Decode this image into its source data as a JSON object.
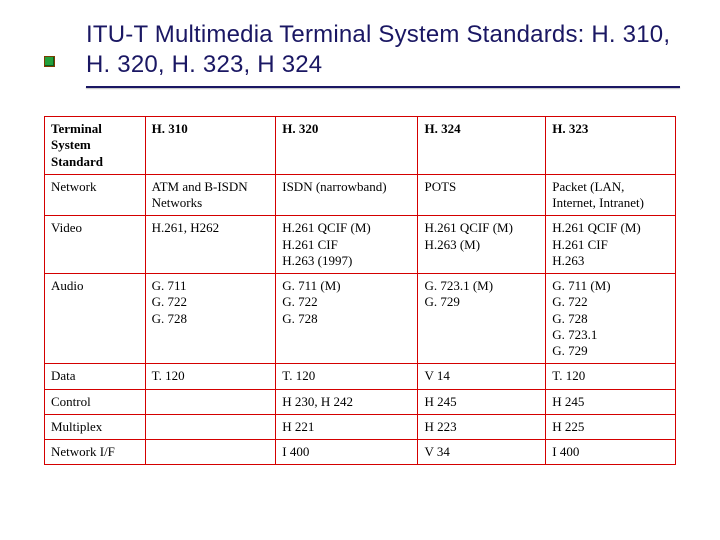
{
  "title": "ITU-T Multimedia Terminal System Standards: H. 310, H. 320, H. 323, H 324",
  "table": {
    "header": [
      "Terminal System Standard",
      "H. 310",
      "H. 320",
      "H. 324",
      "H. 323"
    ],
    "rows": [
      {
        "label": "Network",
        "cells": [
          "ATM and B-ISDN Networks",
          "ISDN (narrowband)",
          "POTS",
          "Packet (LAN, Internet, Intranet)"
        ]
      },
      {
        "label": "Video",
        "cells": [
          "H.261, H262",
          "H.261 QCIF (M)\nH.261 CIF\nH.263 (1997)",
          "H.261 QCIF (M)\nH.263 (M)",
          "H.261 QCIF (M)\nH.261 CIF\nH.263"
        ]
      },
      {
        "label": "Audio",
        "cells": [
          "G. 711\nG. 722\nG. 728",
          "G. 711 (M)\nG. 722\nG. 728",
          "G. 723.1 (M)\nG. 729",
          "G. 711 (M)\nG. 722\nG. 728\nG. 723.1\nG. 729"
        ]
      },
      {
        "label": "Data",
        "cells": [
          "T. 120",
          "T. 120",
          "V 14",
          "T. 120"
        ]
      },
      {
        "label": "Control",
        "cells": [
          "",
          "H 230, H 242",
          "H 245",
          "H 245"
        ]
      },
      {
        "label": "Multiplex",
        "cells": [
          "",
          "H 221",
          "H 223",
          "H 225"
        ]
      },
      {
        "label": "Network I/F",
        "cells": [
          "",
          "I 400",
          "V 34",
          "I 400"
        ]
      }
    ]
  }
}
